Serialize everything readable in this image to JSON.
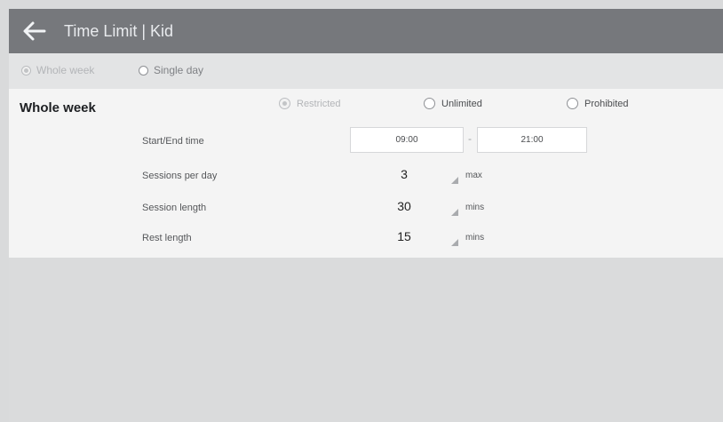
{
  "header": {
    "title": "Time Limit | Kid",
    "back_icon": "arrow-left-icon"
  },
  "mode_tabs": [
    {
      "label": "Whole week",
      "selected": true,
      "enabled": false
    },
    {
      "label": "Single day",
      "selected": false,
      "enabled": true
    }
  ],
  "panel": {
    "title": "Whole week",
    "limit_options": [
      {
        "label": "Restricted",
        "selected": true,
        "enabled": false
      },
      {
        "label": "Unlimited",
        "selected": false,
        "enabled": true
      },
      {
        "label": "Prohibited",
        "selected": false,
        "enabled": true
      }
    ],
    "start_end": {
      "label": "Start/End time",
      "start": "09:00",
      "separator": "-",
      "end": "21:00"
    },
    "rows": [
      {
        "label": "Sessions per day",
        "value": "3",
        "unit": "max"
      },
      {
        "label": "Session length",
        "value": "30",
        "unit": "mins"
      },
      {
        "label": "Rest length",
        "value": "15",
        "unit": "mins"
      }
    ]
  },
  "colors": {
    "header_bg": "#76787c",
    "panel_bg": "#f4f4f4",
    "page_bg": "#d9dadb"
  }
}
